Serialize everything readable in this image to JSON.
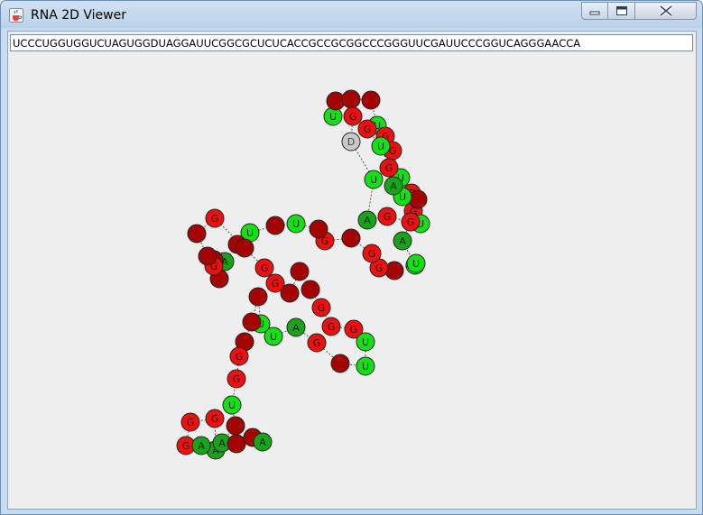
{
  "window": {
    "title": "RNA 2D Viewer",
    "icon": "java-coffee-icon"
  },
  "controls": {
    "minimize": "minimize-icon",
    "maximize": "maximize-icon",
    "close": "close-icon"
  },
  "sequence_field": {
    "value": "UCCCUGGUGGUCUAGUGGDUAGGAUUCGGCGCUCUCACCGCCGCGGCCCGGGUUCGAUUCCCGGUCAGGGAACCA"
  },
  "colors": {
    "A": "#17a417",
    "U": "#13e113",
    "G": "#ee1010",
    "C": "#a40404",
    "D": "#c8c8c8"
  }
}
